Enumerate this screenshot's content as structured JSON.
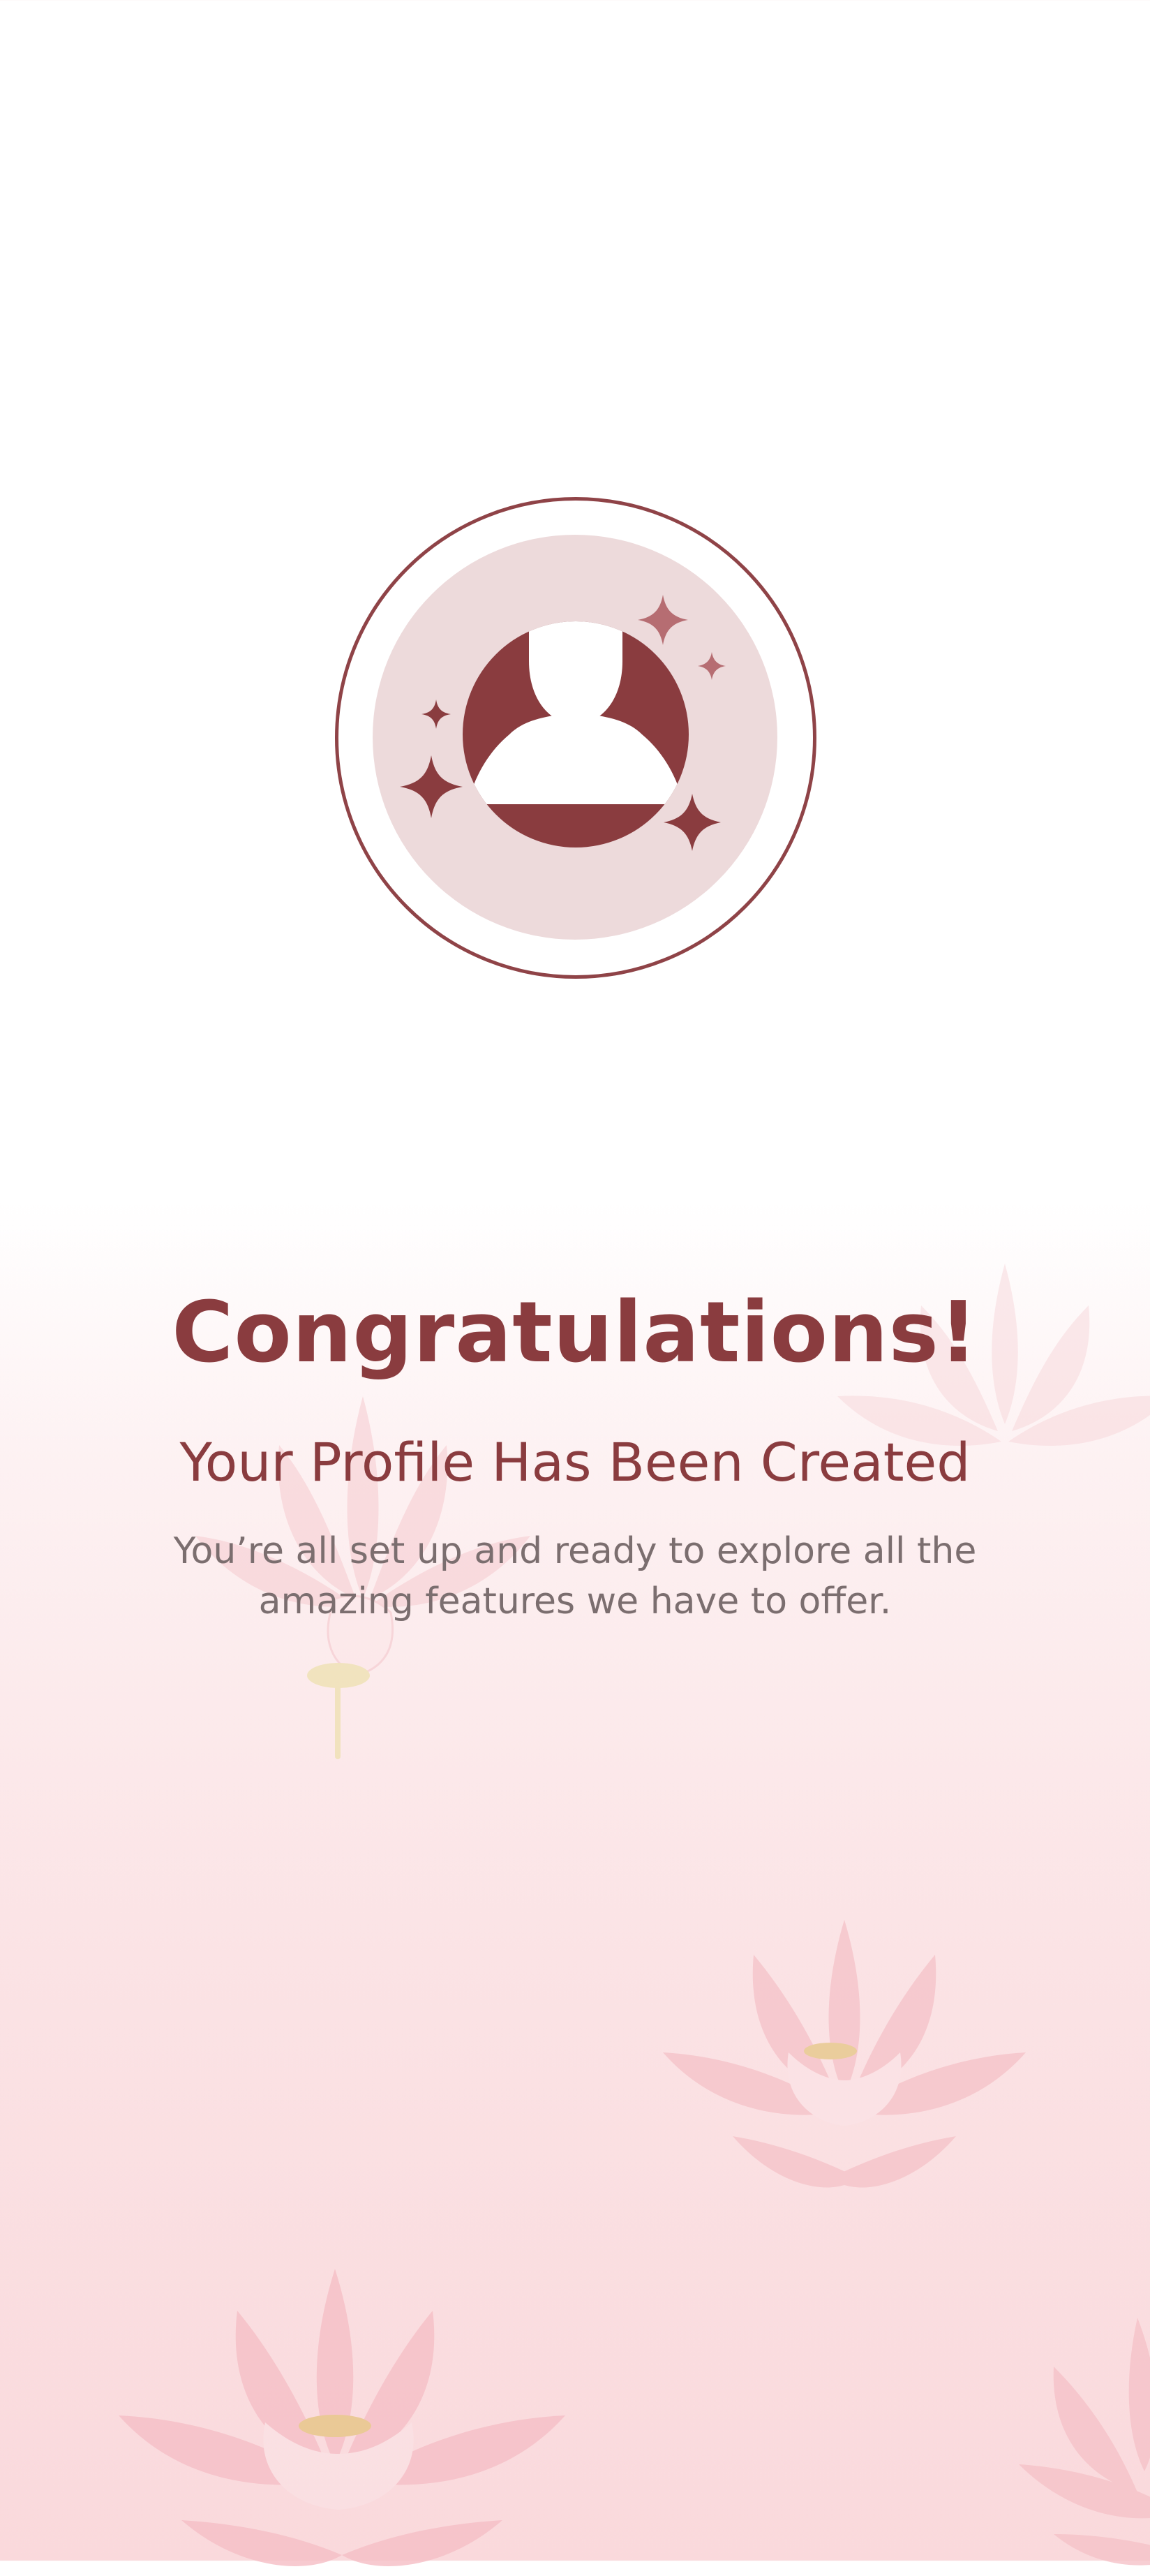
{
  "avatar": {
    "icon": "profile-user-icon",
    "sparkles": "sparkle-icon"
  },
  "success": {
    "title": "Congratulations!",
    "subtitle": "Your Profile Has Been Created",
    "description": "You’re all set up and ready to explore all the amazing features we have to offer."
  },
  "colors": {
    "accent": "#8a3c3f",
    "avatar_bg": "#eddadb",
    "text_muted": "#7b6e6f",
    "lotus_pink": "#f7c6cb"
  }
}
